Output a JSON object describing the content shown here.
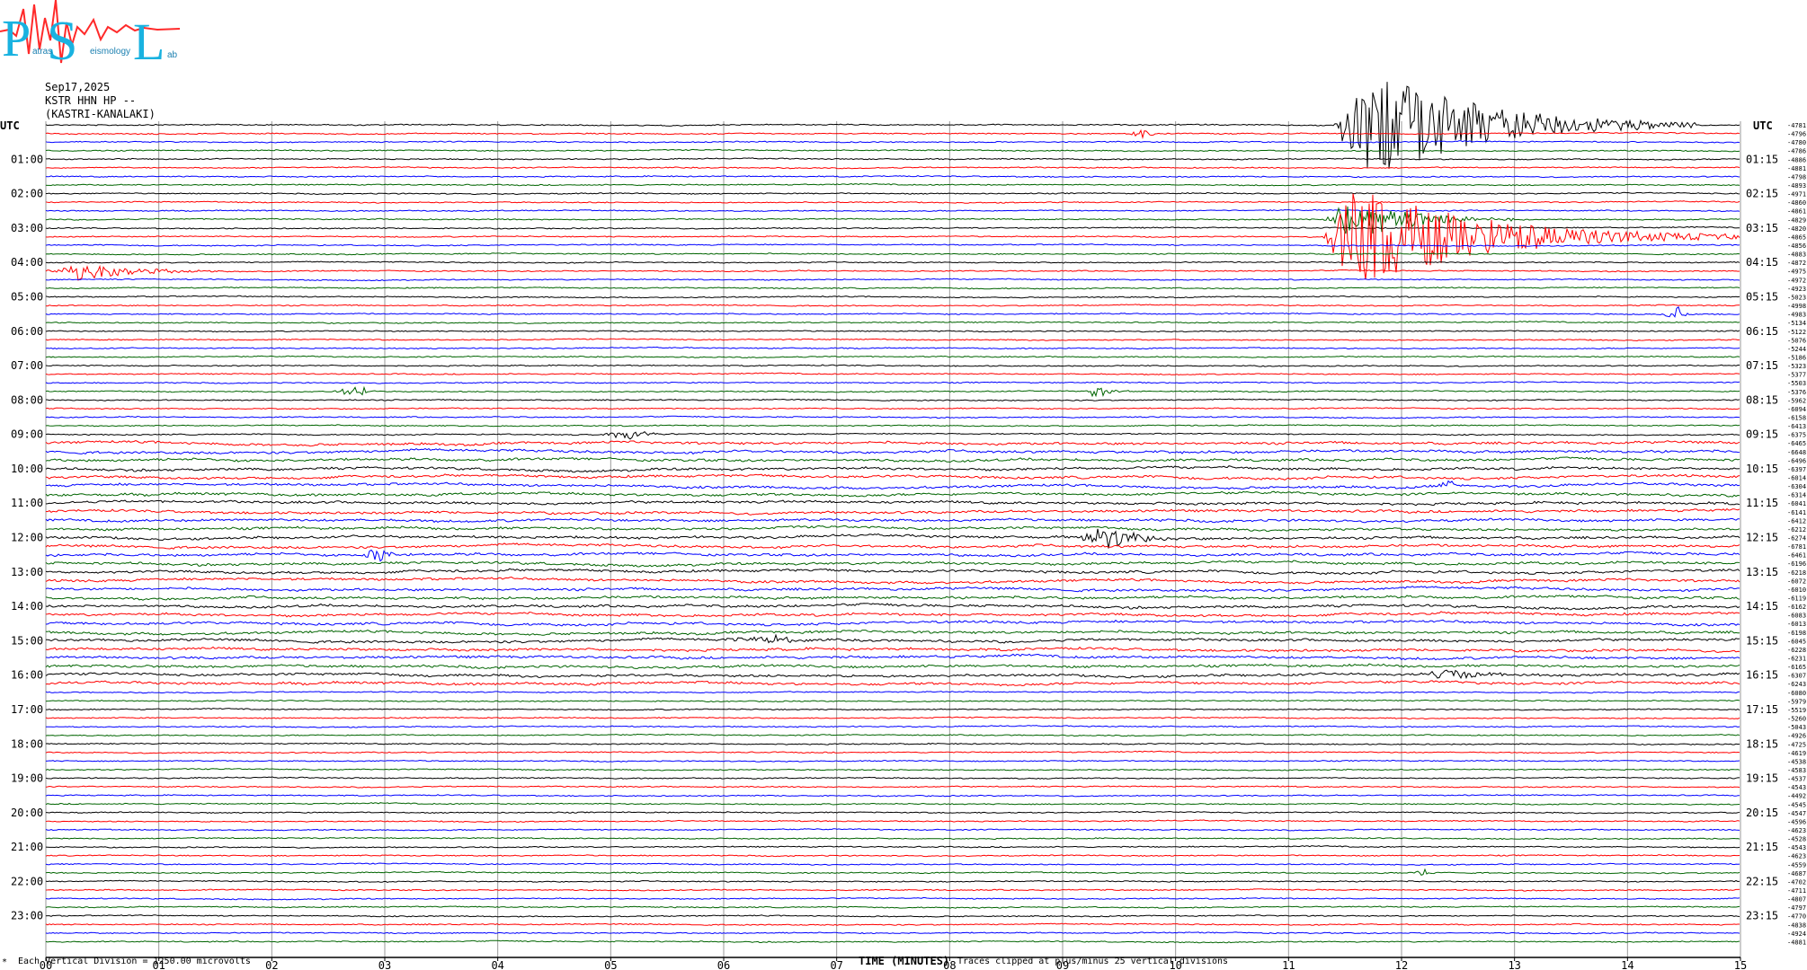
{
  "logo": {
    "letters": [
      "P",
      "S",
      "L"
    ],
    "small_text": [
      "atras",
      "eismology",
      "ab"
    ]
  },
  "header": {
    "date": "Sep17,2025",
    "station": "KSTR HHN HP --",
    "location": "(KASTRI-KANALAKI)"
  },
  "footer": {
    "corner_mark": "*",
    "scale_note": "Each Vertical Division = 1250.00 microvolts",
    "x_title": "TIME (MINUTES)",
    "clip_note": "Traces clipped at plus/minus 25 vertical divisions"
  },
  "chart_data": {
    "type": "line",
    "title": "",
    "xlabel": "TIME (MINUTES)",
    "ylabel": "",
    "xlim": [
      0,
      15
    ],
    "x_ticks": [
      "00",
      "01",
      "02",
      "03",
      "04",
      "05",
      "06",
      "07",
      "08",
      "09",
      "10",
      "11",
      "12",
      "13",
      "14",
      "15"
    ],
    "grid": true,
    "left_axis_title": "UTC",
    "right_axis_title": "UTC",
    "left_hour_labels": [
      "01:00",
      "02:00",
      "03:00",
      "04:00",
      "05:00",
      "06:00",
      "07:00",
      "08:00",
      "09:00",
      "10:00",
      "11:00",
      "12:00",
      "13:00",
      "14:00",
      "15:00",
      "16:00",
      "17:00",
      "18:00",
      "19:00",
      "20:00",
      "21:00",
      "22:00",
      "23:00"
    ],
    "right_hour_labels": [
      "01:15",
      "02:15",
      "03:15",
      "04:15",
      "05:15",
      "06:15",
      "07:15",
      "08:15",
      "09:15",
      "10:15",
      "11:15",
      "12:15",
      "13:15",
      "14:15",
      "15:15",
      "16:15",
      "17:15",
      "18:15",
      "19:15",
      "20:15",
      "21:15",
      "22:15",
      "23:15"
    ],
    "trace_colors": [
      "#000000",
      "#ff0000",
      "#0000ff",
      "#006400"
    ],
    "trace_mean_counts": [
      "-4781",
      "-4796",
      "-4780",
      "-4786",
      "-4886",
      "-4881",
      "-4798",
      "-4893",
      "-4971",
      "-4860",
      "-4861",
      "-4829",
      "-4820",
      "-4865",
      "-4856",
      "-4883",
      "-4872",
      "-4975",
      "-4972",
      "-4923",
      "-5023",
      "-4998",
      "-4983",
      "-5134",
      "-5122",
      "-5076",
      "-5244",
      "-5186",
      "-5323",
      "-5377",
      "-5503",
      "-5376",
      "-5962",
      "-6094",
      "-6158",
      "-6413",
      "-6375",
      "-6465",
      "-6648",
      "-6496",
      "-6397",
      "-6014",
      "-6304",
      "-6314",
      "-6041",
      "-6141",
      "-6412",
      "-6212",
      "-6274",
      "-6781",
      "-6461",
      "-6196",
      "-6218",
      "-6072",
      "-6010",
      "-6119",
      "-6162",
      "-6083",
      "-6013",
      "-6198",
      "-6045",
      "-6228",
      "-6231",
      "-6165",
      "-6307",
      "-6243",
      "-6080",
      "-5979",
      "-5519",
      "-5260",
      "-5043",
      "-4926",
      "-4725",
      "-4619",
      "-4538",
      "-4583",
      "-4537",
      "-4543",
      "-4492",
      "-4545",
      "-4547",
      "-4596",
      "-4623",
      "-4528",
      "-4543",
      "-4623",
      "-4559",
      "-4687",
      "-4702",
      "-4711",
      "-4807",
      "-4797",
      "-4770",
      "-4838",
      "-4924",
      "-4881"
    ],
    "events": [
      {
        "row": 0,
        "start_min": 11.4,
        "peak_min": 11.7,
        "end_min": 14.6,
        "amplitude": 8,
        "label": ""
      },
      {
        "row": 1,
        "start_min": 9.6,
        "peak_min": 9.7,
        "end_min": 9.9,
        "amplitude": 0.7,
        "label": ""
      },
      {
        "row": 11,
        "start_min": 11.3,
        "peak_min": 11.6,
        "end_min": 13.0,
        "amplitude": 3,
        "label": ""
      },
      {
        "row": 13,
        "start_min": 11.3,
        "peak_min": 11.6,
        "end_min": 15.0,
        "amplitude": 7,
        "label": ""
      },
      {
        "row": 13,
        "start_min": 11.55,
        "peak_min": 11.6,
        "end_min": 11.65,
        "amplitude": 11,
        "label": ""
      },
      {
        "row": 17,
        "start_min": 0.0,
        "peak_min": 0.3,
        "end_min": 1.8,
        "amplitude": 1.2,
        "label": ""
      },
      {
        "row": 22,
        "start_min": 14.3,
        "peak_min": 14.45,
        "end_min": 14.6,
        "amplitude": 1,
        "label": ""
      },
      {
        "row": 31,
        "start_min": 9.2,
        "peak_min": 9.3,
        "end_min": 9.6,
        "amplitude": 1.2,
        "label": ""
      },
      {
        "row": 31,
        "start_min": 2.4,
        "peak_min": 2.8,
        "end_min": 3.0,
        "amplitude": 0.6,
        "label": ""
      },
      {
        "row": 36,
        "start_min": 4.9,
        "peak_min": 5.2,
        "end_min": 5.6,
        "amplitude": 0.8,
        "label": ""
      },
      {
        "row": 42,
        "start_min": 12.3,
        "peak_min": 12.45,
        "end_min": 12.6,
        "amplitude": 0.9,
        "label": ""
      },
      {
        "row": 48,
        "start_min": 9.1,
        "peak_min": 9.4,
        "end_min": 10.2,
        "amplitude": 1.6,
        "label": ""
      },
      {
        "row": 50,
        "start_min": 2.8,
        "peak_min": 2.95,
        "end_min": 3.2,
        "amplitude": 1.2,
        "label": ""
      },
      {
        "row": 60,
        "start_min": 6.0,
        "peak_min": 6.5,
        "end_min": 6.8,
        "amplitude": 0.6,
        "label": ""
      },
      {
        "row": 64,
        "start_min": 12.2,
        "peak_min": 12.45,
        "end_min": 13.0,
        "amplitude": 1.0,
        "label": ""
      },
      {
        "row": 87,
        "start_min": 12.1,
        "peak_min": 12.2,
        "end_min": 12.4,
        "amplitude": 0.5,
        "label": ""
      }
    ]
  }
}
